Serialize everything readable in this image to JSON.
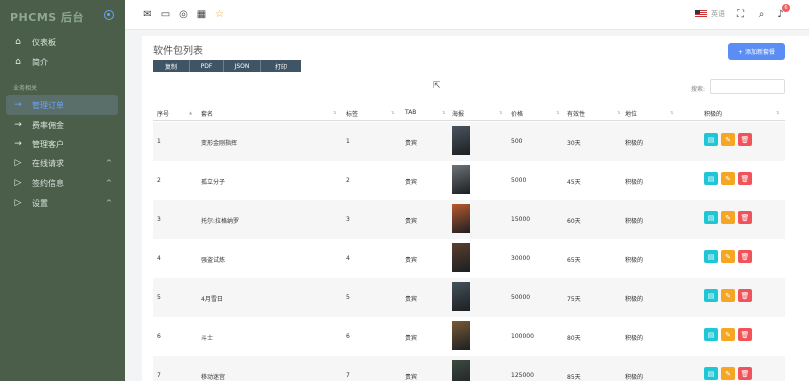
{
  "sidebar": {
    "brand": "PHCMS 后台",
    "section_label": "业务相关",
    "items": [
      {
        "label": "仪表板",
        "icon": "home-icon"
      },
      {
        "label": "简介",
        "icon": "home-icon"
      },
      {
        "label": "管理订单",
        "icon": "arrow-right-icon",
        "active": true
      },
      {
        "label": "费率佣金",
        "icon": "arrow-right-icon"
      },
      {
        "label": "管理客户",
        "icon": "arrow-right-icon"
      },
      {
        "label": "在线请求",
        "icon": "play-icon",
        "chevron": "^"
      },
      {
        "label": "签约信息",
        "icon": "play-icon",
        "chevron": "^"
      },
      {
        "label": "设置",
        "icon": "play-icon",
        "chevron": "^"
      }
    ]
  },
  "topbar": {
    "icons": [
      "mail-icon",
      "chat-icon",
      "check-circle-icon",
      "calendar-icon",
      "star-icon"
    ],
    "language": "英语",
    "notification_count": "6"
  },
  "card": {
    "title": "软件包列表",
    "buttons": [
      "复制",
      "PDF",
      "JSON",
      "打印"
    ],
    "add_button": "+ 添加新套餐",
    "search_label": "搜索:",
    "search_value": ""
  },
  "table": {
    "headers": [
      "序号",
      "套名",
      "标签",
      "TAB",
      "海报",
      "价格",
      "有效性",
      "地位",
      "积极的"
    ],
    "rows": [
      {
        "no": "1",
        "name": "变形金刚指挥",
        "tag": "1",
        "tab": "贵宾",
        "price": "500",
        "validity": "30天",
        "status": "积极的",
        "poster": "#4a5560"
      },
      {
        "no": "2",
        "name": "孤立分子",
        "tag": "2",
        "tab": "贵宾",
        "price": "5000",
        "validity": "45天",
        "status": "积极的",
        "poster": "#6d7378"
      },
      {
        "no": "3",
        "name": "托尔:拉格纳罗",
        "tag": "3",
        "tab": "贵宾",
        "price": "15000",
        "validity": "60天",
        "status": "积极的",
        "poster": "#b85a2e"
      },
      {
        "no": "4",
        "name": "强盗试炼",
        "tag": "4",
        "tab": "贵宾",
        "price": "30000",
        "validity": "65天",
        "status": "积极的",
        "poster": "#5a4030"
      },
      {
        "no": "5",
        "name": "4月雪日",
        "tag": "5",
        "tab": "贵宾",
        "price": "50000",
        "validity": "75天",
        "status": "积极的",
        "poster": "#44525a"
      },
      {
        "no": "6",
        "name": "斗士",
        "tag": "6",
        "tab": "贵宾",
        "price": "100000",
        "validity": "80天",
        "status": "积极的",
        "poster": "#7a5a35"
      },
      {
        "no": "7",
        "name": "移动迷宫",
        "tag": "7",
        "tab": "贵宾",
        "price": "125000",
        "validity": "85天",
        "status": "积极的",
        "poster": "#3c4a40"
      }
    ]
  },
  "colors": {
    "sidebar_bg": "#4a5e4a",
    "accent": "#5b8ef5",
    "view": "#1fc6d6",
    "edit": "#f5a623",
    "delete": "#f0545a"
  }
}
